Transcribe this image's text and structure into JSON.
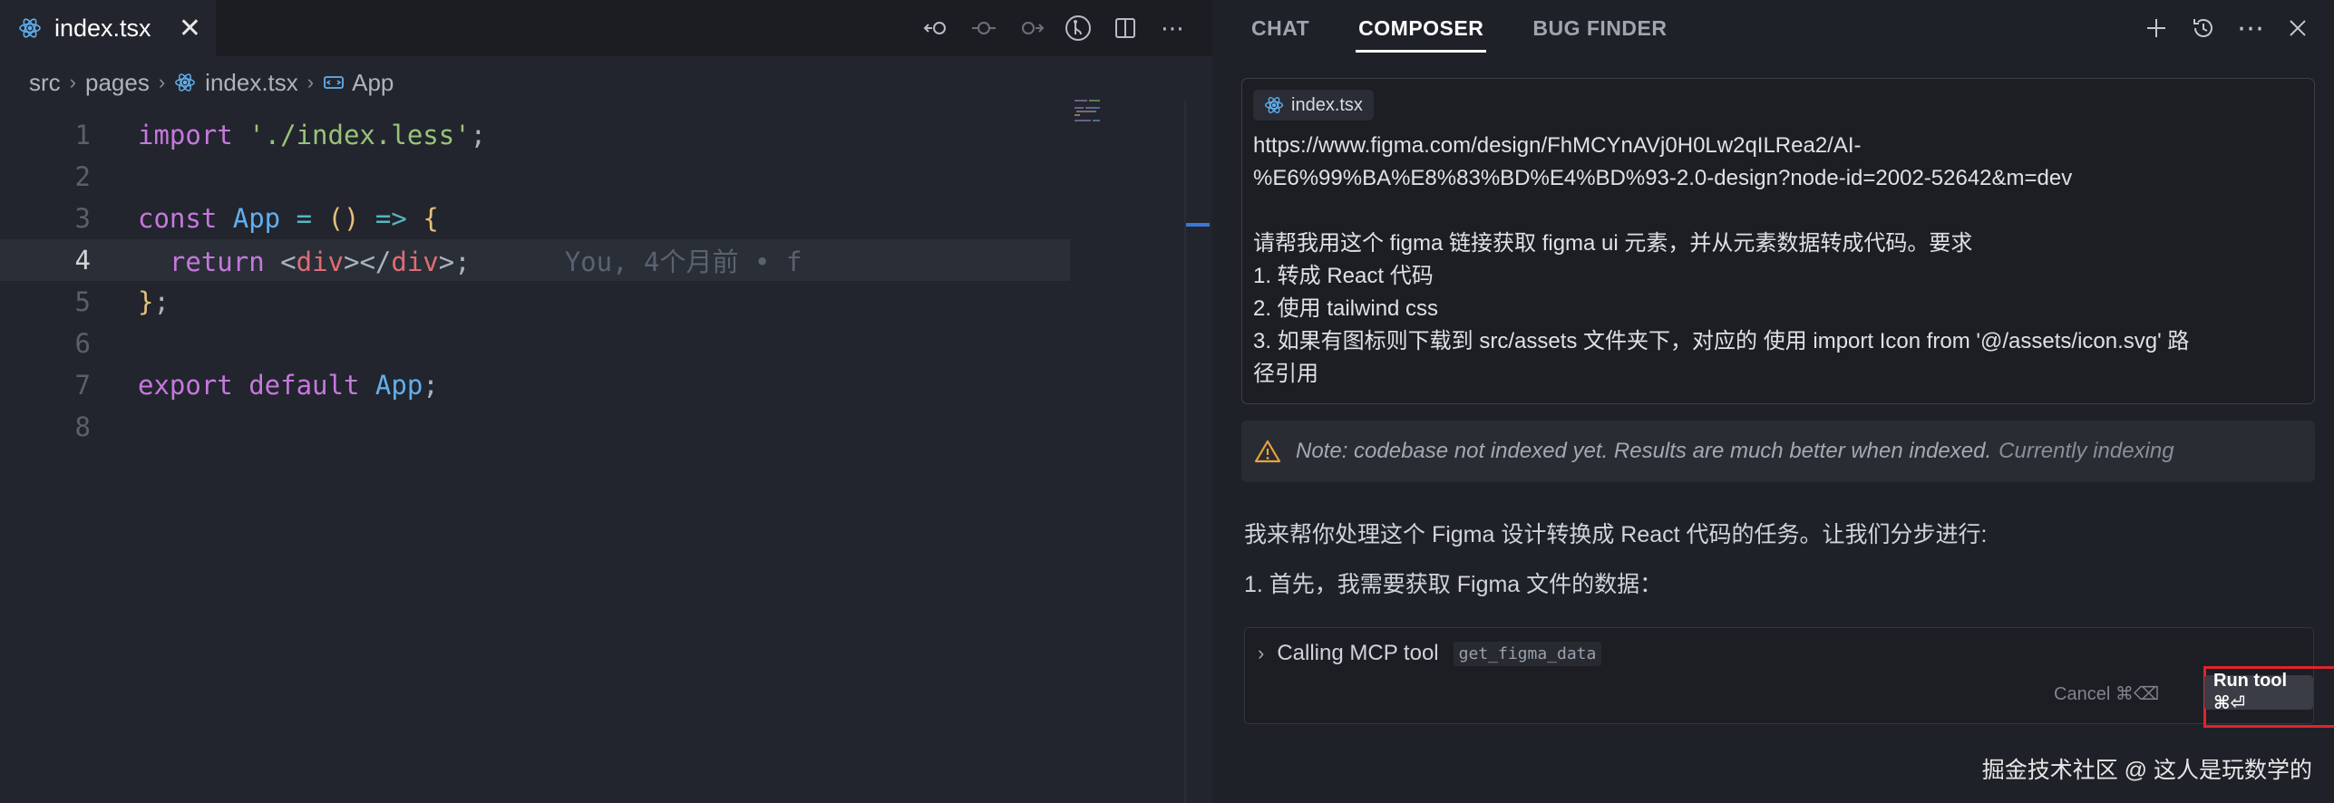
{
  "editor": {
    "tab": {
      "filename": "index.tsx",
      "close_label": "✕"
    },
    "toolbar": {
      "icons": [
        "go-back-icon",
        "commit-icon",
        "go-forward-icon",
        "source-control-icon",
        "split-editor-icon",
        "more-icon"
      ]
    },
    "breadcrumb": [
      "src",
      "pages",
      "index.tsx",
      "App"
    ],
    "code_lines": [
      {
        "n": "1",
        "tokens": [
          [
            "kw",
            "import "
          ],
          [
            "str",
            "'./index.less'"
          ],
          [
            "pun",
            ";"
          ]
        ]
      },
      {
        "n": "2",
        "tokens": []
      },
      {
        "n": "3",
        "tokens": [
          [
            "kw",
            "const "
          ],
          [
            "fn",
            "App"
          ],
          [
            "op",
            " = "
          ],
          [
            "br",
            "()"
          ],
          [
            "op",
            " => "
          ],
          [
            "br",
            "{"
          ]
        ]
      },
      {
        "n": "4",
        "tokens": [
          [
            "kw",
            "  return "
          ],
          [
            "pun",
            "<"
          ],
          [
            "tag",
            "div"
          ],
          [
            "pun",
            "></"
          ],
          [
            "tag",
            "div"
          ],
          [
            "pun",
            ">;"
          ]
        ],
        "ghost": "You, 4个月前 • f",
        "active": true
      },
      {
        "n": "5",
        "tokens": [
          [
            "br",
            "}"
          ],
          [
            "pun",
            ";"
          ]
        ]
      },
      {
        "n": "6",
        "tokens": []
      },
      {
        "n": "7",
        "tokens": [
          [
            "kw",
            "export default "
          ],
          [
            "fn",
            "App"
          ],
          [
            "pun",
            ";"
          ]
        ]
      },
      {
        "n": "8",
        "tokens": []
      }
    ]
  },
  "panel": {
    "tabs": [
      {
        "label": "CHAT",
        "active": false
      },
      {
        "label": "COMPOSER",
        "active": true
      },
      {
        "label": "BUG FINDER",
        "active": false
      }
    ],
    "actions": [
      "plus-icon",
      "history-icon",
      "more-icon",
      "close-icon"
    ],
    "prompt": {
      "chip": "index.tsx",
      "lines": [
        "https://www.figma.com/design/FhMCYnAVj0H0Lw2qILRea2/AI-",
        "%E6%99%BA%E8%83%BD%E4%BD%93-2.0-design?node-id=2002-52642&m=dev",
        "",
        "请帮我用这个 figma 链接获取 figma ui 元素，并从元素数据转成代码。要求",
        "1. 转成 React 代码",
        "2. 使用 tailwind css",
        "3. 如果有图标则下载到 src/assets 文件夹下，对应的 使用 import Icon from '@/assets/icon.svg' 路",
        "径引用"
      ]
    },
    "note": {
      "text": "Note: codebase not indexed yet. Results are much better when indexed.",
      "status": "Currently indexing"
    },
    "ai_lines": [
      "我来帮你处理这个 Figma 设计转换成 React 代码的任务。让我们分步进行:",
      "1. 首先，我需要获取 Figma 文件的数据："
    ],
    "tool": {
      "title": "Calling MCP tool",
      "name": "get_figma_data",
      "cancel": "Cancel ⌘⌫",
      "run": "Run tool ⌘⏎"
    },
    "watermark": "掘金技术社区 @ 这人是玩数学的"
  }
}
